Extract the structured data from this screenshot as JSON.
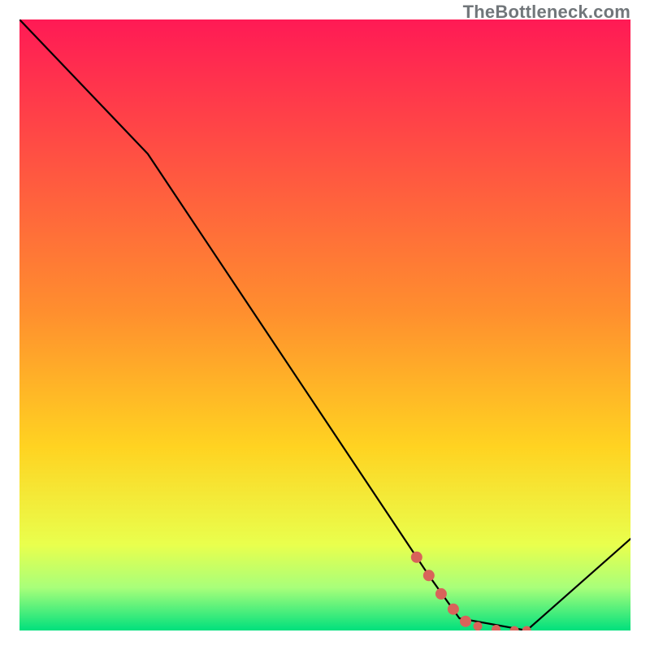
{
  "watermark": "TheBottleneck.com",
  "colors": {
    "gradient_top": "#ff1a55",
    "gradient_mid": "#ffd321",
    "gradient_low": "#d8ff66",
    "gradient_bottom": "#00e07d",
    "curve": "#000000",
    "dots": "#d8635a"
  },
  "chart_data": {
    "type": "line",
    "title": "",
    "xlabel": "",
    "ylabel": "",
    "xlim": [
      0,
      100
    ],
    "ylim": [
      0,
      100
    ],
    "series": [
      {
        "name": "bottleneck-curve",
        "x": [
          0,
          21,
          67,
          72,
          83,
          100
        ],
        "values": [
          100,
          78,
          9,
          2,
          0,
          15
        ]
      }
    ],
    "highlight": {
      "name": "optimal-range",
      "x_start": 65,
      "x_end": 83,
      "points": [
        {
          "x": 65,
          "y": 12
        },
        {
          "x": 67,
          "y": 9
        },
        {
          "x": 69,
          "y": 6
        },
        {
          "x": 71,
          "y": 3.5
        },
        {
          "x": 73,
          "y": 1.5
        },
        {
          "x": 75,
          "y": 0.7
        },
        {
          "x": 78,
          "y": 0.2
        },
        {
          "x": 81,
          "y": 0
        },
        {
          "x": 83,
          "y": 0
        }
      ]
    }
  }
}
